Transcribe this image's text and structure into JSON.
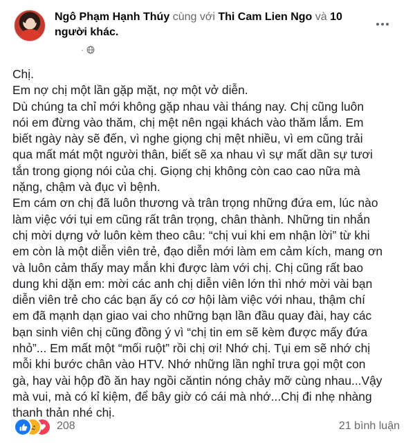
{
  "post": {
    "author": "Ngô Phạm Hạnh Thúy",
    "with_text": "cùng với",
    "tagged": "Thi Cam Lien Ngo",
    "and_text": "và",
    "others": "10 người khác.",
    "privacy_icon": "globe-icon"
  },
  "body_lines": [
    "Chị.",
    "Em nợ chị một lần gặp mặt, nợ một vở diễn.",
    "Dù chúng ta chỉ mới không gặp nhau vài tháng nay. Chị cũng luôn",
    "nói em đừng vào thăm, chị mệt nên ngại khách vào thăm lắm. Em",
    "biết ngày này sẽ đến, vì nghe giọng chị mệt nhiều, vì em cũng trải",
    "qua mất mát một người thân, biết sẽ xa nhau vì sự mất dần sự tươi",
    "tắn trong giọng nói của chị. Giọng chị không còn cao cao nữa mà",
    "nặng, chậm và đục vì bệnh.",
    "Em cám ơn chị đã luôn thương và trân trọng những đứa em, lúc nào",
    "làm việc với tụi em cũng rất trân trọng, chân thành. Những tin nhắn",
    "chị mời dựng vở luôn kèm theo câu: “chị vui khi em nhận lời” từ khi",
    "em còn là một diễn viên trẻ, đạo diễn mới làm em cảm kích, mang ơn",
    "và luôn cảm thấy may mắn khi được làm với chị. Chị cũng rất bao",
    "dung khi dặn em: mời các anh chị diễn viên lớn thì nhớ mời vài bạn",
    "diễn viên trẻ cho các bạn ấy có cơ hội làm việc với nhau, thậm chí",
    "em đã mạnh dạn giao vai cho những bạn lần đầu quay đài, hay các",
    "bạn sinh viên chị cũng đồng ý vì “chị tin em sẽ kèm được mấy đứa",
    "nhỏ”... Em mất một “mối ruột” rồi chị ơi! Nhớ chị. Tụi em sẽ nhớ chị",
    "mỗi khi bước chân vào HTV. Nhớ những lần nghỉ trưa gọi một con",
    "gà, hay vài hộp đồ ăn hay ngồi căntin nóng chảy mỡ cùng nhau...Vậy",
    "mà vui, mà có kỉ kiệm, để bây giờ có cái mà nhớ...Chị đi nhẹ nhàng",
    "thanh thản nhé chị."
  ],
  "footer": {
    "reaction_count": "208",
    "comments": "21 bình luận",
    "reaction_icons": [
      "like-icon",
      "sad-icon",
      "love-icon"
    ]
  },
  "colors": {
    "like": "#1877f2",
    "sad": "#f7b125",
    "love": "#f33e58",
    "secondary_text": "#65676b"
  }
}
